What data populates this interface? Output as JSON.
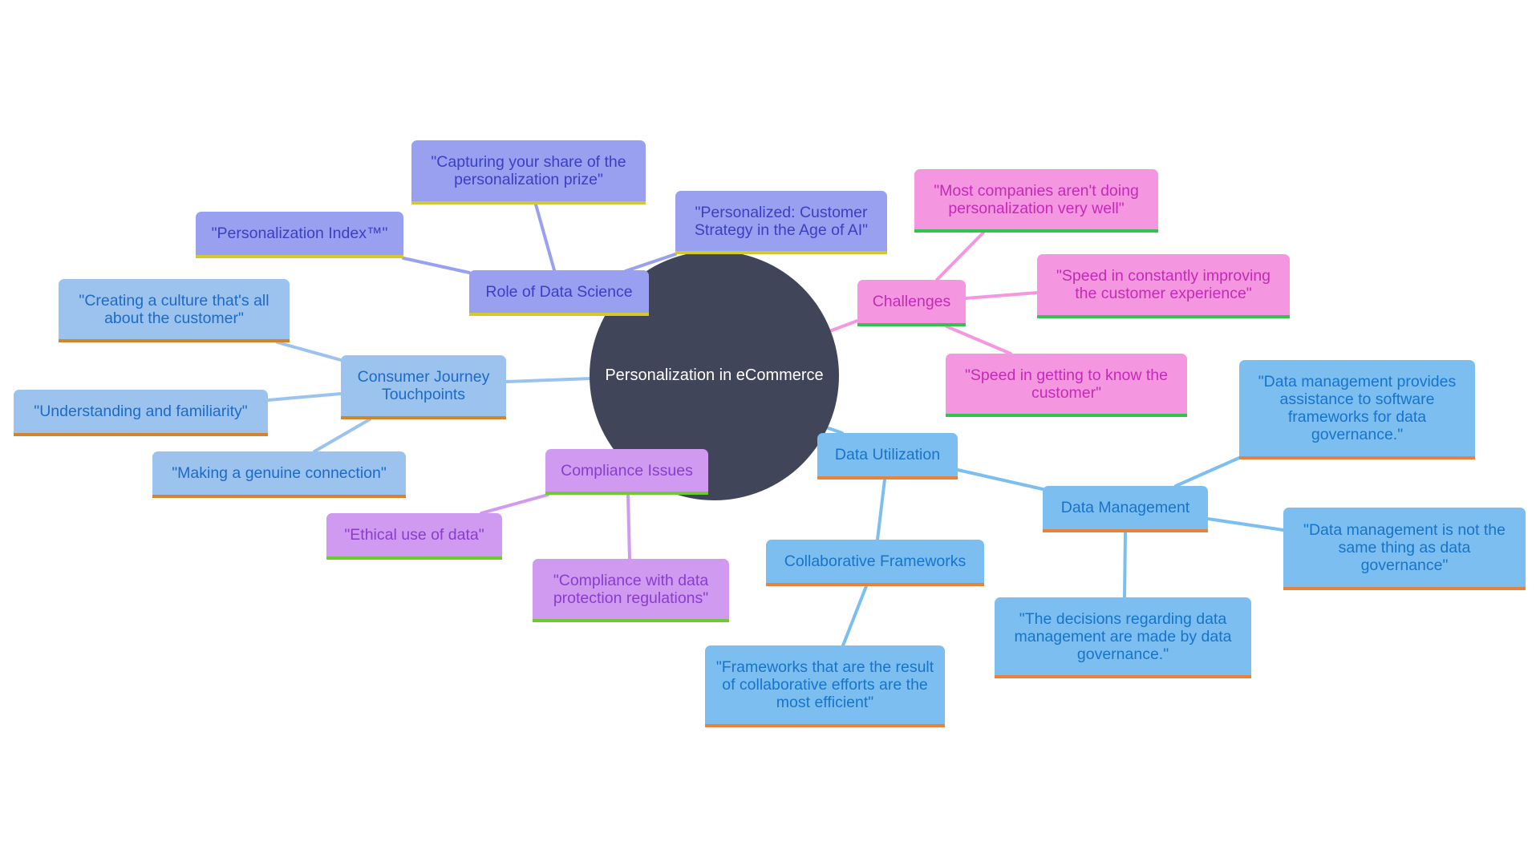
{
  "diagram": {
    "type": "mind-map",
    "root": "Personalization in eCommerce",
    "colors": {
      "root": "#414559",
      "indigo": "#9aa0f0",
      "sky": "#9bc3ee",
      "pink": "#f497e0",
      "purple": "#cf9af0",
      "blue": "#7cbef0"
    },
    "branches": {
      "role_of_data_science": {
        "label": "Role of Data Science",
        "children": [
          "\"Capturing your share of the personalization prize\"",
          "\"Personalization Index™\"",
          "\"Personalized: Customer Strategy in the Age of AI\""
        ]
      },
      "consumer_journey": {
        "label": "Consumer Journey Touchpoints",
        "children": [
          "\"Creating a culture that's all about the customer\"",
          "\"Understanding and familiarity\"",
          "\"Making a genuine connection\""
        ]
      },
      "compliance": {
        "label": "Compliance Issues",
        "children": [
          "\"Ethical use of data\"",
          "\"Compliance with data protection regulations\""
        ]
      },
      "challenges": {
        "label": "Challenges",
        "children": [
          "\"Most companies aren't doing personalization very well\"",
          "\"Speed in constantly improving the customer experience\"",
          "\"Speed in getting to know the customer\""
        ]
      },
      "data_utilization": {
        "label": "Data Utilization",
        "collaborative": {
          "label": "Collaborative Frameworks",
          "children": [
            "\"Frameworks that are the result of collaborative efforts are the most efficient\""
          ]
        },
        "data_management": {
          "label": "Data Management",
          "children": [
            "\"Data management provides assistance to software frameworks for data governance.\"",
            "\"Data management is not the same thing as data governance\"",
            "\"The decisions regarding data management are made by data governance.\""
          ]
        }
      }
    }
  }
}
